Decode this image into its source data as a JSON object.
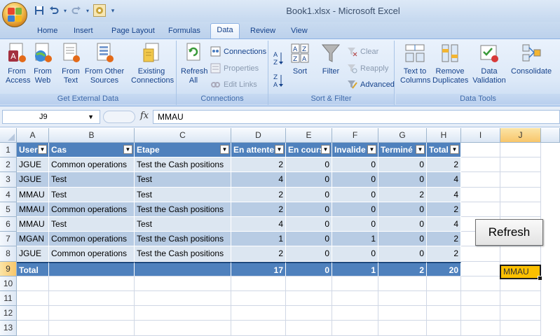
{
  "window": {
    "title": "Book1.xlsx - Microsoft Excel"
  },
  "tabs": [
    "Home",
    "Insert",
    "Page Layout",
    "Formulas",
    "Data",
    "Review",
    "View"
  ],
  "active_tab": "Data",
  "ribbon": {
    "get_external_data": {
      "label": "Get External Data",
      "from_access": "From Access",
      "from_web": "From Web",
      "from_text": "From Text",
      "from_other_sources": "From Other Sources",
      "existing_connections": "Existing Connections"
    },
    "connections": {
      "label": "Connections",
      "refresh_all": "Refresh All",
      "connections": "Connections",
      "properties": "Properties",
      "edit_links": "Edit Links"
    },
    "sort_filter": {
      "label": "Sort & Filter",
      "sort": "Sort",
      "filter": "Filter",
      "clear": "Clear",
      "reapply": "Reapply",
      "advanced": "Advanced"
    },
    "data_tools": {
      "label": "Data Tools",
      "text_to_columns": "Text to Columns",
      "remove_duplicates": "Remove Duplicates",
      "data_validation": "Data Validation",
      "consolidate": "Consolidate"
    }
  },
  "formula_bar": {
    "name_box": "J9",
    "fx": "fx",
    "formula": "MMAU"
  },
  "columns": [
    "A",
    "B",
    "C",
    "D",
    "E",
    "F",
    "G",
    "H",
    "I",
    "J"
  ],
  "rows": [
    "1",
    "2",
    "3",
    "4",
    "5",
    "6",
    "7",
    "8",
    "9",
    "10",
    "11",
    "12",
    "13"
  ],
  "table": {
    "headers": [
      "User",
      "Cas",
      "Etape",
      "En attente",
      "En cours",
      "Invalide",
      "Terminé",
      "Total"
    ],
    "rows": [
      [
        "JGUE",
        "Common operations",
        "Test the Cash positions",
        "2",
        "0",
        "0",
        "0",
        "2"
      ],
      [
        "JGUE",
        "Test",
        "Test",
        "4",
        "0",
        "0",
        "0",
        "4"
      ],
      [
        "MMAU",
        "Test",
        "Test",
        "2",
        "0",
        "0",
        "2",
        "4"
      ],
      [
        "MMAU",
        "Common operations",
        "Test the Cash positions",
        "2",
        "0",
        "0",
        "0",
        "2"
      ],
      [
        "MMAU",
        "Test",
        "Test",
        "4",
        "0",
        "0",
        "0",
        "4"
      ],
      [
        "MGAN",
        "Common operations",
        "Test the Cash positions",
        "1",
        "0",
        "1",
        "0",
        "2"
      ],
      [
        "JGUE",
        "Common operations",
        "Test the Cash positions",
        "2",
        "0",
        "0",
        "0",
        "2"
      ]
    ],
    "total": [
      "Total",
      "",
      "",
      "17",
      "0",
      "1",
      "2",
      "20"
    ]
  },
  "refresh_button": "Refresh",
  "j9_value": "MMAU",
  "colors": {
    "header": "#4f81bd",
    "band_light": "#dce6f1",
    "band_dark": "#b8cce4",
    "active_cell": "#fbc000"
  }
}
